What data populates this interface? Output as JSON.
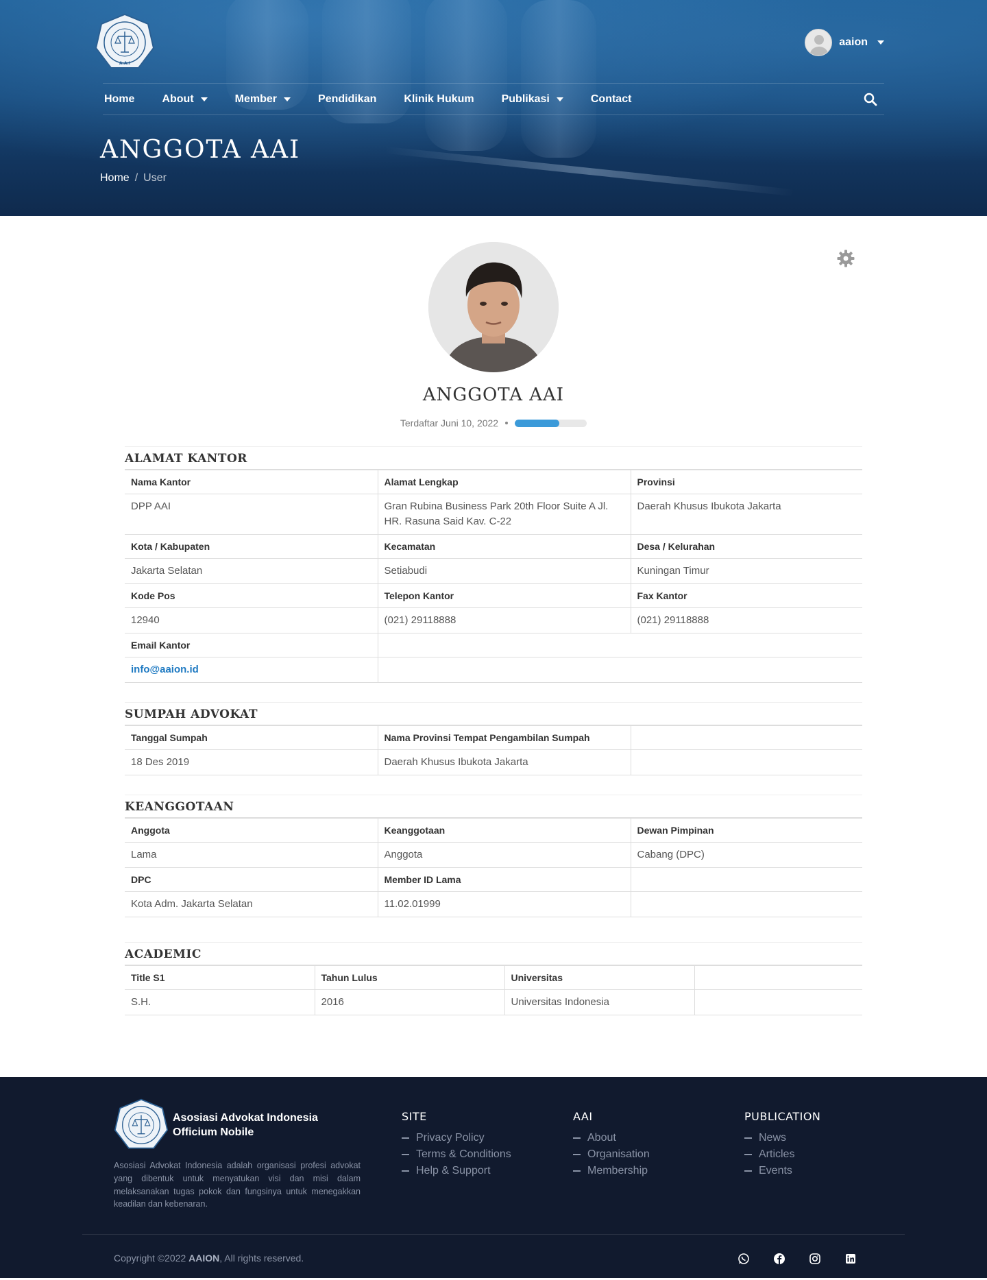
{
  "header": {
    "logo_text_ring": "ASOSIASI ADVOKAT INDONESIA",
    "logo_text_bottom": "A.A.I",
    "user_name": "aaion",
    "nav": [
      {
        "label": "Home",
        "dropdown": false
      },
      {
        "label": "About",
        "dropdown": true
      },
      {
        "label": "Member",
        "dropdown": true
      },
      {
        "label": "Pendidikan",
        "dropdown": false
      },
      {
        "label": "Klinik Hukum",
        "dropdown": false
      },
      {
        "label": "Publikasi",
        "dropdown": true
      },
      {
        "label": "Contact",
        "dropdown": false
      }
    ],
    "page_title": "ANGGOTA AAI",
    "breadcrumb": {
      "home": "Home",
      "sep": "/",
      "current": "User"
    }
  },
  "profile": {
    "name": "ANGGOTA AAI",
    "registered": "Terdaftar Juni 10, 2022",
    "progress": 0.62
  },
  "sections": {
    "alamat": {
      "title": "ALAMAT KANTOR",
      "nama_kantor_label": "Nama Kantor",
      "nama_kantor": "DPP AAI",
      "alamat_label": "Alamat Lengkap",
      "alamat": "Gran Rubina Business Park 20th Floor Suite A Jl. HR. Rasuna Said Kav. C-22",
      "provinsi_label": "Provinsi",
      "provinsi": "Daerah Khusus Ibukota Jakarta",
      "kota_label": "Kota / Kabupaten",
      "kota": "Jakarta Selatan",
      "kecamatan_label": "Kecamatan",
      "kecamatan": "Setiabudi",
      "desa_label": "Desa / Kelurahan",
      "desa": "Kuningan Timur",
      "kodepos_label": "Kode Pos",
      "kodepos": "12940",
      "telepon_label": "Telepon Kantor",
      "telepon": "(021) 29118888",
      "fax_label": "Fax Kantor",
      "fax": "(021) 29118888",
      "email_label": "Email Kantor",
      "email": "info@aaion.id"
    },
    "sumpah": {
      "title": "SUMPAH ADVOKAT",
      "tanggal_label": "Tanggal Sumpah",
      "tanggal": "18 Des 2019",
      "provinsi_label": "Nama Provinsi Tempat Pengambilan Sumpah",
      "provinsi": "Daerah Khusus Ibukota Jakarta"
    },
    "keanggotaan": {
      "title": "KEANGGOTAAN",
      "anggota_label": "Anggota",
      "anggota": "Lama",
      "keanggotaan_label": "Keanggotaan",
      "keanggotaan": "Anggota",
      "dewan_label": "Dewan Pimpinan",
      "dewan": "Cabang (DPC)",
      "dpc_label": "DPC",
      "dpc": "Kota Adm. Jakarta Selatan",
      "member_id_label": "Member ID Lama",
      "member_id": "11.02.01999"
    },
    "academic": {
      "title": "ACADEMIC",
      "title_s1_label": "Title S1",
      "title_s1": "S.H.",
      "tahun_label": "Tahun Lulus",
      "tahun": "2016",
      "universitas_label": "Universitas",
      "universitas": "Universitas Indonesia"
    }
  },
  "footer": {
    "brand_line1": "Asosiasi Advokat Indonesia",
    "brand_line2": "Officium Nobile",
    "description": "Asosiasi Advokat Indonesia adalah organisasi profesi advokat yang dibentuk untuk menyatukan visi dan misi dalam melaksanakan tugas pokok dan fungsinya untuk menegakkan keadilan dan kebenaran.",
    "columns": [
      {
        "title": "SITE",
        "links": [
          "Privacy Policy",
          "Terms & Conditions",
          "Help & Support"
        ]
      },
      {
        "title": "AAI",
        "links": [
          "About",
          "Organisation",
          "Membership"
        ]
      },
      {
        "title": "PUBLICATION",
        "links": [
          "News",
          "Articles",
          "Events"
        ]
      }
    ],
    "copyright_prefix": "Copyright ©2022 ",
    "copyright_brand": "AAION",
    "copyright_suffix": ", All rights reserved.",
    "social": [
      "whatsapp-icon",
      "facebook-icon",
      "instagram-icon",
      "linkedin-icon"
    ]
  },
  "colors": {
    "hero": "#174a7c",
    "accent": "#3b9ad9",
    "link": "#1f7ac2",
    "footer": "#111a2e"
  }
}
